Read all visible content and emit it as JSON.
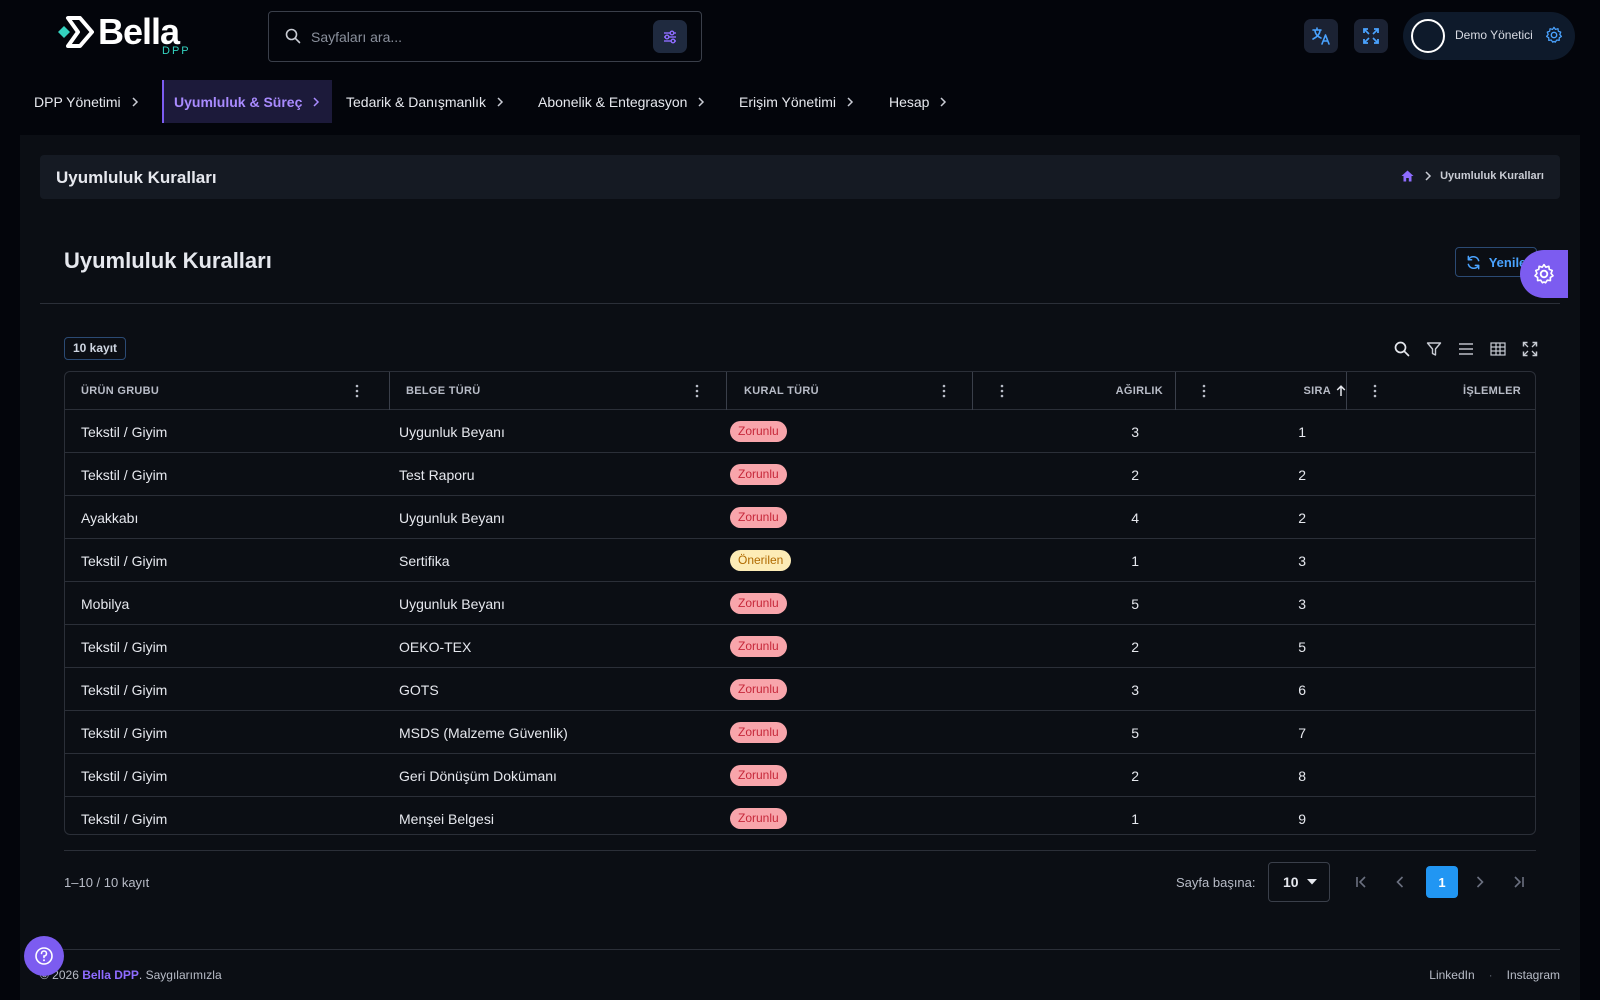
{
  "app": {
    "logo_text": "Bella",
    "logo_sub": "DPP"
  },
  "search": {
    "placeholder": "Sayfaları ara..."
  },
  "user": {
    "name": "Demo Yönetici"
  },
  "nav": {
    "items": [
      {
        "label": "DPP Yönetimi",
        "active": false
      },
      {
        "label": "Uyumluluk & Süreç",
        "active": true
      },
      {
        "label": "Tedarik & Danışmanlık",
        "active": false
      },
      {
        "label": "Abonelik & Entegrasyon",
        "active": false
      },
      {
        "label": "Erişim Yönetimi",
        "active": false
      },
      {
        "label": "Hesap",
        "active": false
      }
    ]
  },
  "title_bar": {
    "title": "Uyumluluk Kuralları",
    "breadcrumb_current": "Uyumluluk Kuralları"
  },
  "page": {
    "title": "Uyumluluk Kuralları",
    "refresh_label": "Yenile",
    "record_count": "10 kayıt"
  },
  "table": {
    "columns": [
      "ÜRÜN GRUBU",
      "BELGE TÜRÜ",
      "KURAL TÜRÜ",
      "AĞIRLIK",
      "SIRA",
      "İŞLEMLER"
    ],
    "sorted_column": "SIRA",
    "sort_direction": "asc",
    "rows": [
      {
        "group": "Tekstil / Giyim",
        "doc": "Uygunluk Beyanı",
        "rule": "Zorunlu",
        "weight": "3",
        "order": "1"
      },
      {
        "group": "Tekstil / Giyim",
        "doc": "Test Raporu",
        "rule": "Zorunlu",
        "weight": "2",
        "order": "2"
      },
      {
        "group": "Ayakkabı",
        "doc": "Uygunluk Beyanı",
        "rule": "Zorunlu",
        "weight": "4",
        "order": "2"
      },
      {
        "group": "Tekstil / Giyim",
        "doc": "Sertifika",
        "rule": "Önerilen",
        "weight": "1",
        "order": "3"
      },
      {
        "group": "Mobilya",
        "doc": "Uygunluk Beyanı",
        "rule": "Zorunlu",
        "weight": "5",
        "order": "3"
      },
      {
        "group": "Tekstil / Giyim",
        "doc": "OEKO-TEX",
        "rule": "Zorunlu",
        "weight": "2",
        "order": "5"
      },
      {
        "group": "Tekstil / Giyim",
        "doc": "GOTS",
        "rule": "Zorunlu",
        "weight": "3",
        "order": "6"
      },
      {
        "group": "Tekstil / Giyim",
        "doc": "MSDS (Malzeme Güvenlik)",
        "rule": "Zorunlu",
        "weight": "5",
        "order": "7"
      },
      {
        "group": "Tekstil / Giyim",
        "doc": "Geri Dönüşüm Dokümanı",
        "rule": "Zorunlu",
        "weight": "2",
        "order": "8"
      },
      {
        "group": "Tekstil / Giyim",
        "doc": "Menşei Belgesi",
        "rule": "Zorunlu",
        "weight": "1",
        "order": "9"
      }
    ]
  },
  "pagination": {
    "range_text": "1–10 / 10 kayıt",
    "per_page_label": "Sayfa başına:",
    "per_page_value": "10",
    "current_page": "1"
  },
  "footer": {
    "copyright_prefix": "© 2026",
    "brand": "Bella DPP",
    "copyright_suffix": ". Saygılarımızla",
    "links": [
      "LinkedIn",
      "Instagram"
    ]
  },
  "colors": {
    "accent_purple": "#7c5cf0",
    "accent_blue": "#2196f3",
    "pill_required_bg": "#f8a5ab",
    "pill_required_text": "#c6283a",
    "pill_recommended_bg": "#fdecb6",
    "pill_recommended_text": "#b06a00"
  }
}
